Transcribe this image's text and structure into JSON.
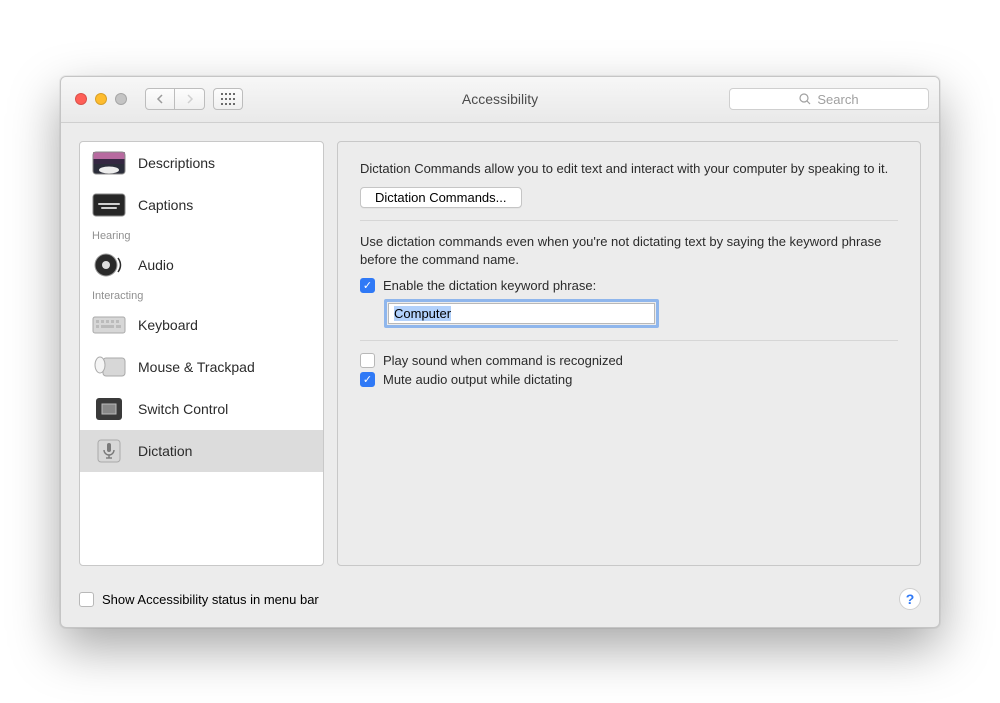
{
  "window": {
    "title": "Accessibility"
  },
  "search": {
    "placeholder": "Search"
  },
  "sidebar": {
    "items": [
      {
        "label": "Descriptions"
      },
      {
        "label": "Captions"
      }
    ],
    "groups": [
      {
        "header": "Hearing",
        "items": [
          {
            "label": "Audio"
          }
        ]
      },
      {
        "header": "Interacting",
        "items": [
          {
            "label": "Keyboard"
          },
          {
            "label": "Mouse & Trackpad"
          },
          {
            "label": "Switch Control"
          },
          {
            "label": "Dictation"
          }
        ]
      }
    ]
  },
  "main": {
    "intro": "Dictation Commands allow you to edit text and interact with your computer by speaking to it.",
    "commands_button": "Dictation Commands...",
    "keyword_intro": "Use dictation commands even when you're not dictating text by saying the keyword phrase before the command name.",
    "enable_keyword_label": "Enable the dictation keyword phrase:",
    "keyword_value": "Computer",
    "play_sound_label": "Play sound when command is recognized",
    "mute_label": "Mute audio output while dictating"
  },
  "footer": {
    "status_label": "Show Accessibility status in menu bar"
  }
}
